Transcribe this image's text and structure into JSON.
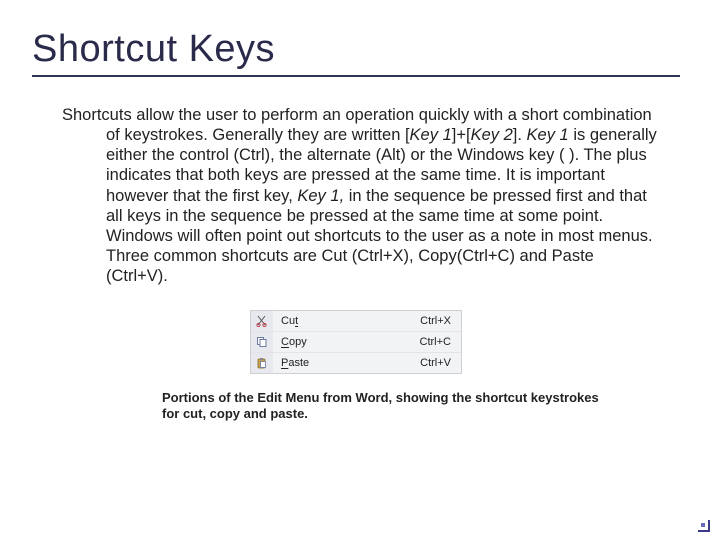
{
  "title": "Shortcut Keys",
  "body": {
    "prefix": "Shortcuts allow the user to perform an operation quickly with a short combination of keystrokes.  Generally they are written [",
    "k1": "Key 1",
    "mid1": "]+[",
    "k2": "Key 2",
    "mid2": "].  ",
    "k3": "Key 1",
    "mid3": " is generally either the control (Ctrl), the alternate (Alt) or the Windows key (   ).  The plus indicates that both keys are pressed at the same time.  It is important however that the first key, ",
    "k4": "Key 1,",
    "suffix": " in the sequence be pressed first and that all keys in the sequence be pressed at the same time at some point.  Windows will often point out shortcuts to the user as a note in most menus.  Three common shortcuts are Cut (Ctrl+X), Copy(Ctrl+C) and Paste (Ctrl+V)."
  },
  "menu": {
    "rows": [
      {
        "icon": "cut-icon",
        "labelU": "t",
        "labelPre": "Cu",
        "labelPost": "",
        "key": "Ctrl+X"
      },
      {
        "icon": "copy-icon",
        "labelU": "C",
        "labelPre": "",
        "labelPost": "opy",
        "key": "Ctrl+C"
      },
      {
        "icon": "paste-icon",
        "labelU": "P",
        "labelPre": "",
        "labelPost": "aste",
        "key": "Ctrl+V"
      }
    ]
  },
  "caption": "Portions of the Edit Menu from Word, showing the shortcut keystrokes for cut, copy and paste."
}
